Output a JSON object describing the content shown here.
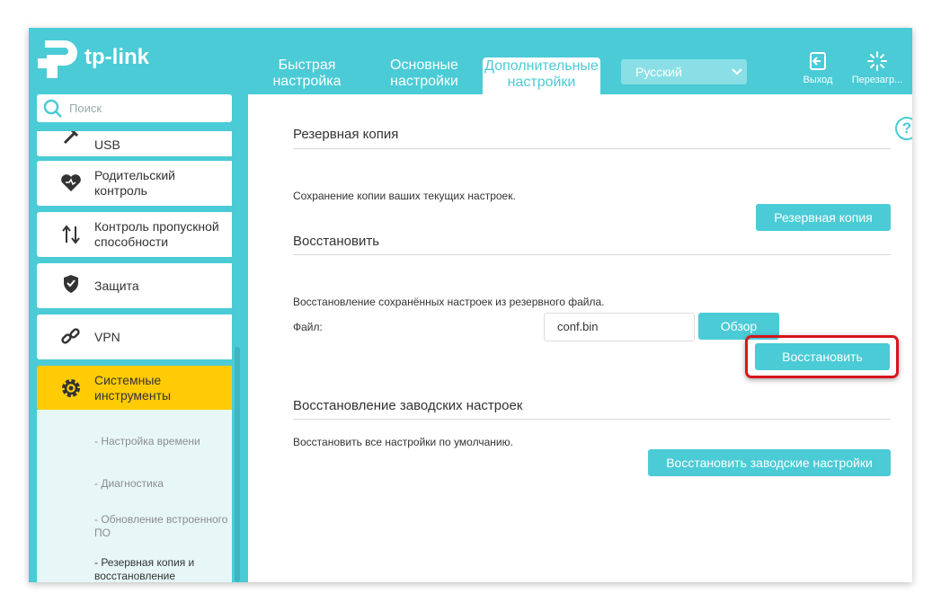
{
  "brand": {
    "logo_text": "tp-link"
  },
  "header": {
    "tabs": [
      {
        "label": "Быстрая\nнастройка"
      },
      {
        "label": "Основные\nнастройки"
      },
      {
        "label": "Дополнительные\nнастройки",
        "active": true
      }
    ],
    "language": {
      "selected": "Русский"
    },
    "logout_label": "Выход",
    "reboot_label": "Перезагр..."
  },
  "sidebar": {
    "search_placeholder": "Поиск",
    "items": [
      {
        "label": "USB",
        "icon": "usb-icon"
      },
      {
        "label": "Родительский\nконтроль",
        "icon": "heart-icon"
      },
      {
        "label": "Контроль пропускной\nспособности",
        "icon": "updown-arrows-icon"
      },
      {
        "label": "Защита",
        "icon": "shield-icon"
      },
      {
        "label": "VPN",
        "icon": "link-icon"
      },
      {
        "label": "Системные\nинструменты",
        "icon": "gear-icon",
        "active": true
      }
    ],
    "subitems": [
      {
        "label": "- Настройка времени"
      },
      {
        "label": "- Диагностика"
      },
      {
        "label": "- Обновление встроенного\n  ПО"
      },
      {
        "label": "- Резервная копия и\n  восстановление",
        "current": true
      }
    ]
  },
  "content": {
    "backup": {
      "title": "Резервная копия",
      "description": "Сохранение копии ваших текущих настроек.",
      "button": "Резервная копия"
    },
    "restore": {
      "title": "Восстановить",
      "description": "Восстановление сохранённых настроек из резервного файла.",
      "file_label": "Файл:",
      "file_value": "conf.bin",
      "browse_button": "Обзор",
      "restore_button": "Восстановить"
    },
    "factory": {
      "title": "Восстановление заводских настроек",
      "description": "Восстановить все настройки по умолчанию.",
      "button": "Восстановить заводские настройки"
    }
  },
  "colors": {
    "accent": "#4acbd6",
    "active_menu": "#ffcb05",
    "highlight": "#d8141c"
  }
}
